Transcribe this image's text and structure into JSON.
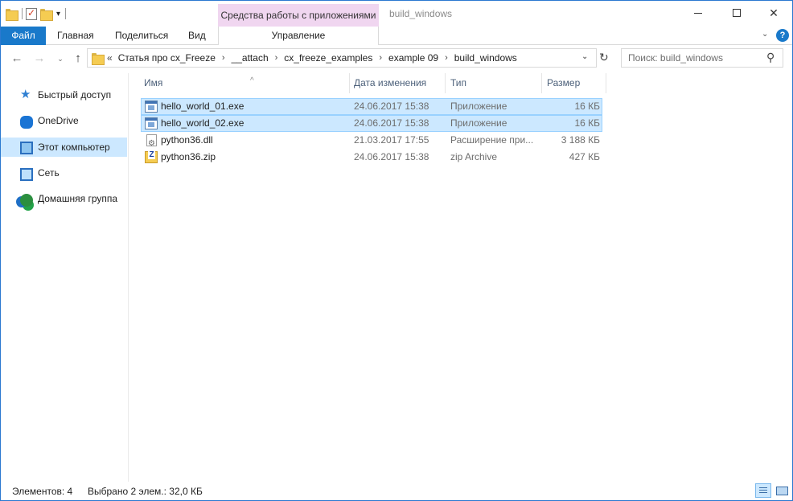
{
  "titlebar": {
    "context_tab": "Средства работы с приложениями",
    "window_title": "build_windows",
    "minimize_icon": "minimize-icon",
    "maximize_icon": "maximize-icon",
    "close_label": "✕"
  },
  "ribbon": {
    "tabs": [
      {
        "label": "Файл"
      },
      {
        "label": "Главная"
      },
      {
        "label": "Поделиться"
      },
      {
        "label": "Вид"
      },
      {
        "label": "Управление"
      }
    ],
    "help_label": "?"
  },
  "navigation": {
    "back": "←",
    "forward": "→",
    "recent": "⌄",
    "up": "↑",
    "breadcrumb_lead": "«",
    "breadcrumbs": [
      "Статья про cx_Freeze",
      "__attach",
      "cx_freeze_examples",
      "example 09",
      "build_windows"
    ],
    "separator": "›",
    "refresh": "↻"
  },
  "search": {
    "placeholder": "Поиск: build_windows",
    "icon": "search-icon"
  },
  "sidebar": {
    "items": [
      {
        "label": "Быстрый доступ",
        "icon": "star-icon",
        "selected": false
      },
      {
        "label": "OneDrive",
        "icon": "cloud-icon",
        "selected": false
      },
      {
        "label": "Этот компьютер",
        "icon": "computer-icon",
        "selected": true
      },
      {
        "label": "Сеть",
        "icon": "network-icon",
        "selected": false
      },
      {
        "label": "Домашняя группа",
        "icon": "homegroup-icon",
        "selected": false
      }
    ]
  },
  "file_list": {
    "columns": {
      "name": "Имя",
      "date": "Дата изменения",
      "type": "Тип",
      "size": "Размер"
    },
    "sort_indicator": "^",
    "rows": [
      {
        "name": "hello_world_01.exe",
        "date": "24.06.2017 15:38",
        "type": "Приложение",
        "size": "16 КБ",
        "selected": true,
        "icon": "exe-icon"
      },
      {
        "name": "hello_world_02.exe",
        "date": "24.06.2017 15:38",
        "type": "Приложение",
        "size": "16 КБ",
        "selected": true,
        "icon": "exe-icon"
      },
      {
        "name": "python36.dll",
        "date": "21.03.2017 17:55",
        "type": "Расширение при...",
        "size": "3 188 КБ",
        "selected": false,
        "icon": "dll-icon"
      },
      {
        "name": "python36.zip",
        "date": "24.06.2017 15:38",
        "type": "zip Archive",
        "size": "427 КБ",
        "selected": false,
        "icon": "zip-icon"
      }
    ]
  },
  "statusbar": {
    "item_count": "Элементов: 4",
    "selection": "Выбрано 2 элем.: 32,0 КБ"
  },
  "colors": {
    "accent": "#1979ca",
    "selection_bg": "#cce8ff",
    "selection_border": "#99d1ff",
    "context_tab_bg": "#f0d6f0"
  }
}
